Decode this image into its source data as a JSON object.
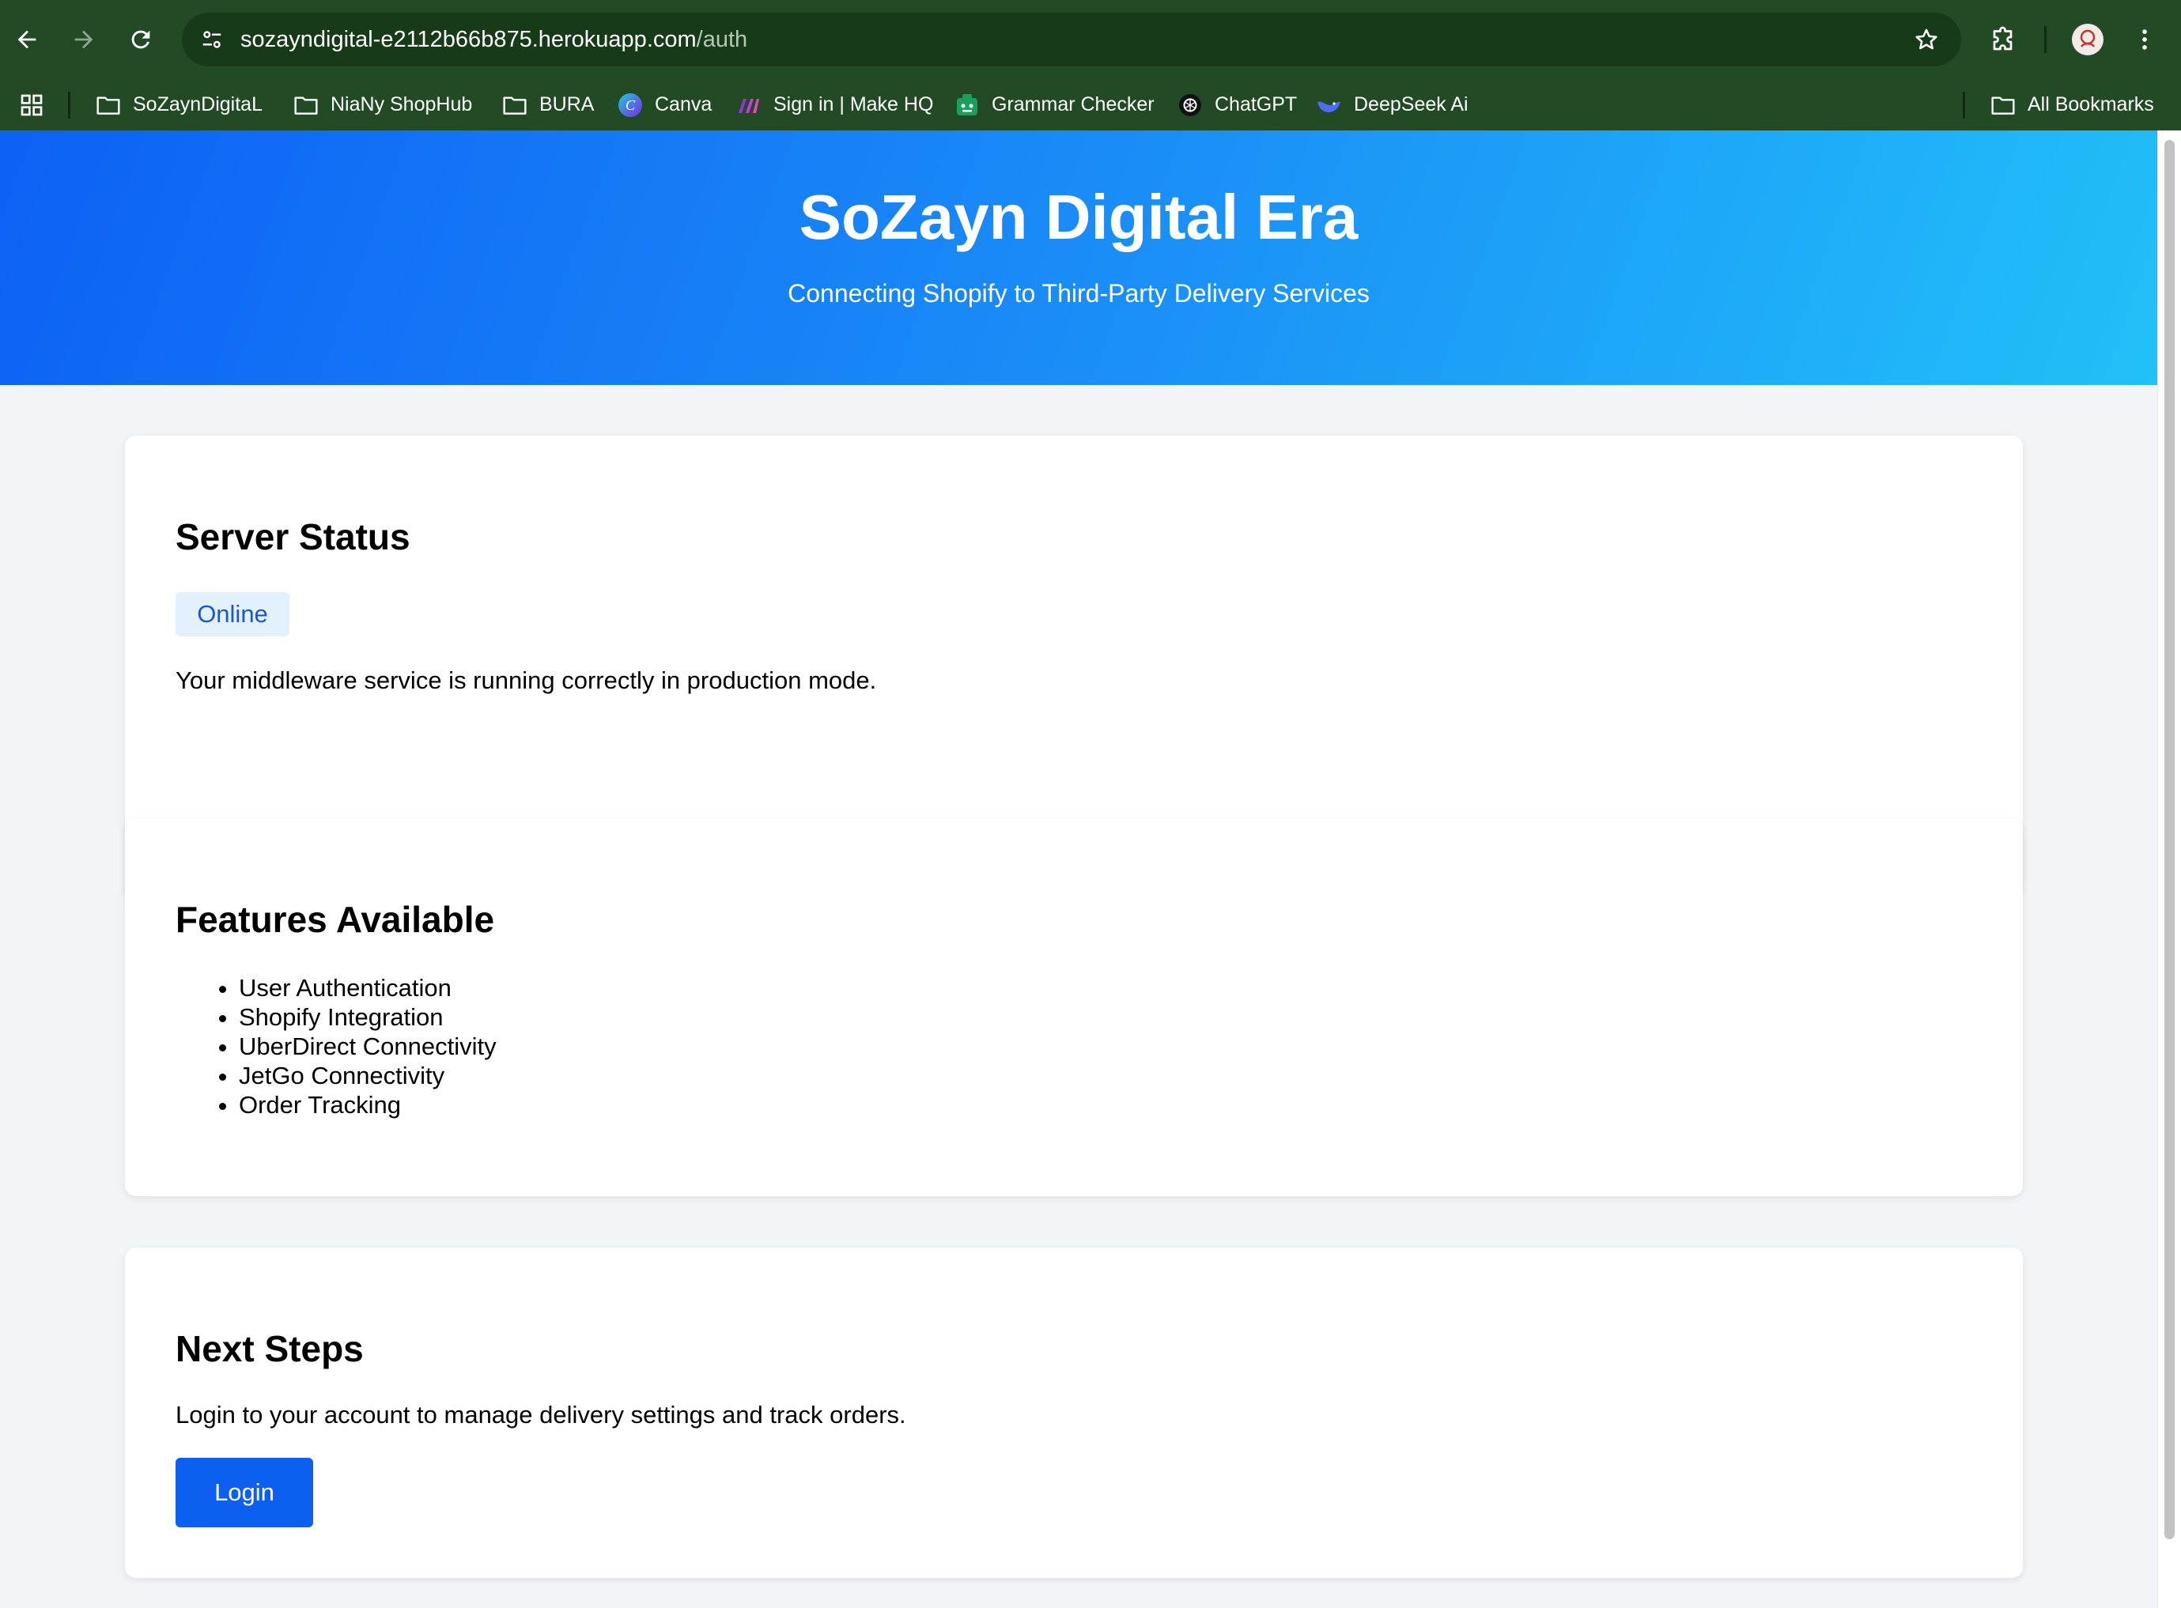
{
  "browser": {
    "url_host": "sozayndigital-e2112b66b875.herokuapp.com",
    "url_path": "/auth",
    "bookmarks": [
      {
        "label": "SoZaynDigitaL",
        "icon": "folder-icon"
      },
      {
        "label": "NiaNy ShopHub",
        "icon": "folder-icon"
      },
      {
        "label": "BURA",
        "icon": "folder-icon"
      },
      {
        "label": "Canva",
        "icon": "canva-icon"
      },
      {
        "label": "Sign in | Make HQ",
        "icon": "make-icon"
      },
      {
        "label": "Grammar Checker",
        "icon": "grammar-icon"
      },
      {
        "label": "ChatGPT",
        "icon": "chatgpt-icon"
      },
      {
        "label": "DeepSeek Ai",
        "icon": "deepseek-icon"
      }
    ],
    "all_bookmarks": "All Bookmarks"
  },
  "hero": {
    "title": "SoZayn Digital Era",
    "subtitle": "Connecting Shopify to Third-Party Delivery Services"
  },
  "status_card": {
    "heading": "Server Status",
    "badge": "Online",
    "message": "Your middleware service is running correctly in production mode."
  },
  "features_card": {
    "heading": "Features Available",
    "items": [
      "User Authentication",
      "Shopify Integration",
      "UberDirect Connectivity",
      "JetGo Connectivity",
      "Order Tracking"
    ]
  },
  "next_card": {
    "heading": "Next Steps",
    "message": "Login to your account to manage delivery settings and track orders.",
    "button": "Login"
  },
  "colors": {
    "chrome": "#224a24",
    "hero_start": "#0d61f5",
    "hero_end": "#21c0f8",
    "button": "#0d5ff0",
    "badge_bg": "#e3f0fd",
    "badge_text": "#1957d4"
  }
}
